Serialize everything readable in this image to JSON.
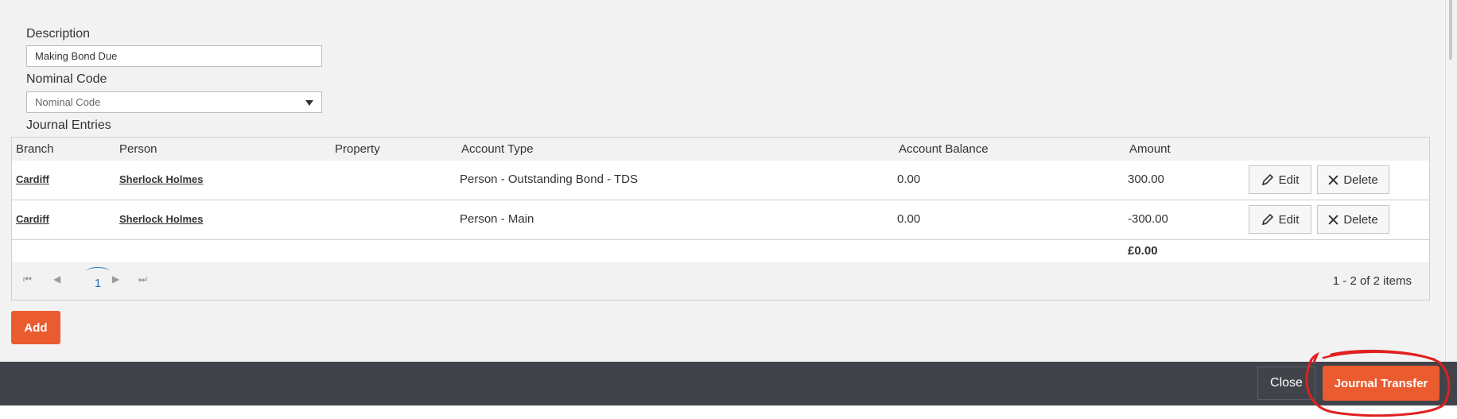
{
  "form": {
    "description_label": "Description",
    "description_value": "Making Bond Due",
    "nominal_label": "Nominal Code",
    "nominal_placeholder": "Nominal Code",
    "journal_entries_label": "Journal Entries"
  },
  "grid": {
    "headers": [
      "Branch",
      "Person",
      "Property",
      "Account Type",
      "Account Balance",
      "Amount"
    ],
    "rows": [
      {
        "branch": "Cardiff",
        "person": "Sherlock Holmes",
        "property": "",
        "account_type": "Person - Outstanding Bond - TDS",
        "balance": "0.00",
        "amount": "300.00"
      },
      {
        "branch": "Cardiff",
        "person": "Sherlock Holmes",
        "property": "",
        "account_type": "Person - Main",
        "balance": "0.00",
        "amount": "-300.00"
      }
    ],
    "total": "£0.00",
    "edit_label": "Edit",
    "delete_label": "Delete"
  },
  "pager": {
    "current_page": "1",
    "info": "1 - 2 of 2 items"
  },
  "actions": {
    "add_label": "Add",
    "close_label": "Close",
    "journal_transfer_label": "Journal Transfer"
  },
  "colors": {
    "accent": "#ea5b30",
    "footer": "#404349",
    "annotation": "#e02020"
  }
}
